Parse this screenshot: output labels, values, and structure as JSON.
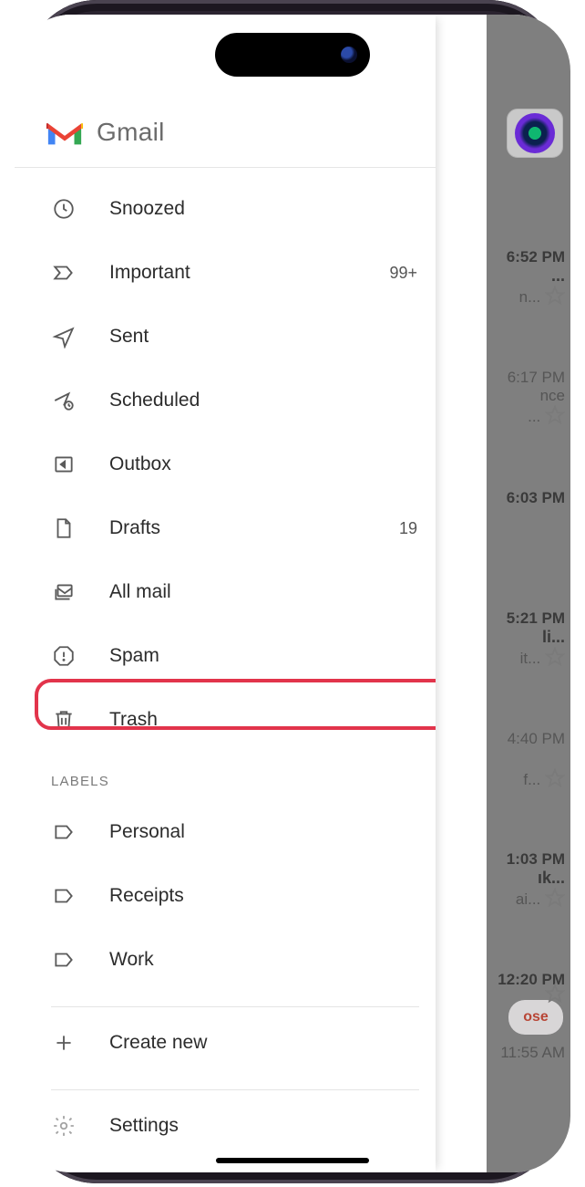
{
  "app": {
    "name": "Gmail"
  },
  "drawer": {
    "items": [
      {
        "icon": "clock",
        "label": "Snoozed",
        "count": ""
      },
      {
        "icon": "important",
        "label": "Important",
        "count": "99+"
      },
      {
        "icon": "sent",
        "label": "Sent",
        "count": ""
      },
      {
        "icon": "scheduled",
        "label": "Scheduled",
        "count": ""
      },
      {
        "icon": "outbox",
        "label": "Outbox",
        "count": ""
      },
      {
        "icon": "draft",
        "label": "Drafts",
        "count": "19"
      },
      {
        "icon": "allmail",
        "label": "All mail",
        "count": ""
      },
      {
        "icon": "spam",
        "label": "Spam",
        "count": ""
      },
      {
        "icon": "trash",
        "label": "Trash",
        "count": ""
      }
    ],
    "labels_header": "LABELS",
    "labels": [
      {
        "label": "Personal"
      },
      {
        "label": "Receipts"
      },
      {
        "label": "Work"
      }
    ],
    "create_new": "Create new",
    "settings": "Settings"
  },
  "inbox_peek": [
    {
      "time": "6:52 PM",
      "l1": "...",
      "l2": "n...",
      "star": true
    },
    {
      "time": "6:17 PM",
      "l1": "nce",
      "l2": "...",
      "star": true,
      "time_light": true
    },
    {
      "time": "6:03 PM",
      "l1": "",
      "l2": "",
      "star": false
    },
    {
      "time": "5:21 PM",
      "l1": "li...",
      "l2": "it...",
      "star": true
    },
    {
      "time": "4:40 PM",
      "l1": "",
      "l2": "f...",
      "star": true
    },
    {
      "time": "1:03 PM",
      "l1": "ık...",
      "l2": "ai...",
      "star": true
    },
    {
      "time": "12:20 PM",
      "l1": "",
      "l2": "",
      "star": true
    },
    {
      "time": "11:55 AM",
      "l1": "",
      "l2": "",
      "star": false
    }
  ],
  "compose_label": "ose"
}
